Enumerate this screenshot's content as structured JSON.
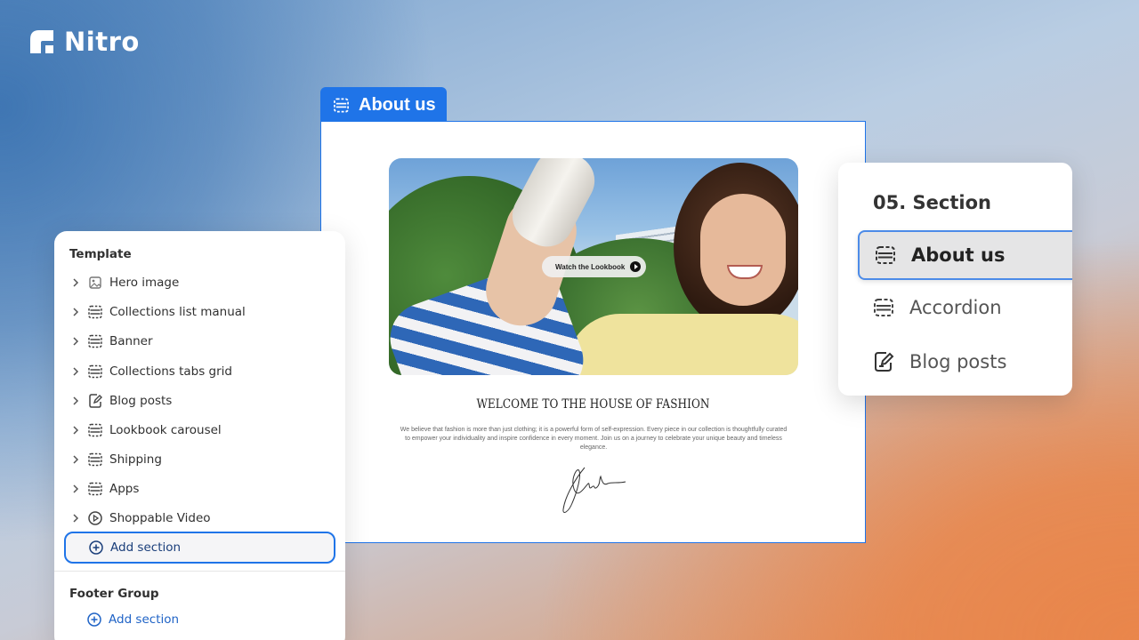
{
  "brand": {
    "name": "Nitro"
  },
  "preview": {
    "tab_label": "About us",
    "lookbook_button": "Watch the Lookbook",
    "heading": "WELCOME TO THE HOUSE OF FASHION",
    "body": "We believe that fashion is more than just clothing; it is a powerful form of self-expression. Every piece in our collection is thoughtfully curated to empower your individuality and inspire confidence in every moment. Join us on a journey to celebrate your unique beauty and timeless elegance."
  },
  "template_panel": {
    "title": "Template",
    "items": [
      {
        "label": "Hero image",
        "icon": "image-icon"
      },
      {
        "label": "Collections list manual",
        "icon": "section-icon"
      },
      {
        "label": "Banner",
        "icon": "section-icon"
      },
      {
        "label": "Collections tabs grid",
        "icon": "section-icon"
      },
      {
        "label": "Blog posts",
        "icon": "edit-doc-icon"
      },
      {
        "label": "Lookbook carousel",
        "icon": "section-icon"
      },
      {
        "label": "Shipping",
        "icon": "section-icon"
      },
      {
        "label": "Apps",
        "icon": "section-icon"
      },
      {
        "label": "Shoppable Video",
        "icon": "play-circle-icon"
      }
    ],
    "add_section": "Add section",
    "footer_title": "Footer Group",
    "footer_add_section": "Add section"
  },
  "section_panel": {
    "title": "05. Section",
    "items": [
      {
        "label": "About us",
        "icon": "section-icon",
        "selected": true
      },
      {
        "label": "Accordion",
        "icon": "section-icon",
        "selected": false
      },
      {
        "label": "Blog posts",
        "icon": "edit-doc-icon",
        "selected": false
      }
    ]
  },
  "colors": {
    "accent": "#1f74e8",
    "panel_bg": "#ffffff"
  }
}
